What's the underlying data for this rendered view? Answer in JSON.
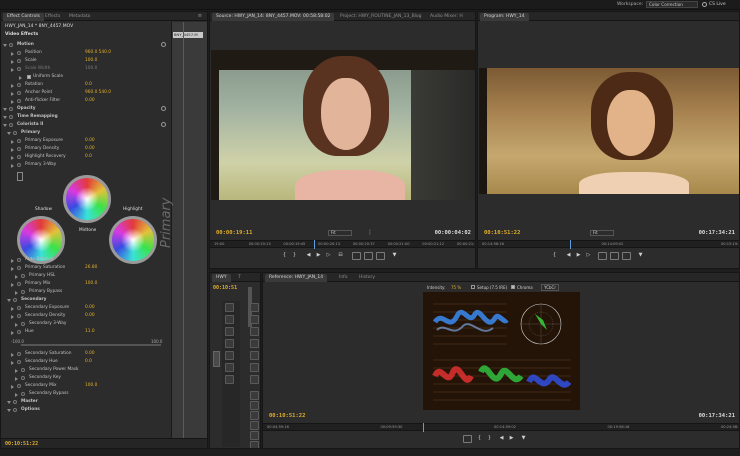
{
  "topbar": {
    "workspace_label": "Workspace:",
    "workspace_value": "Color Correction",
    "cs_live": "CS Live"
  },
  "effect_controls": {
    "tabs": [
      "Effect Controls",
      "Effects",
      "Metadata"
    ],
    "clip_name": "HWY_JAN_14 * 8NY_4457.MOV",
    "mini_clip": "8NY_4457.M",
    "section": "Video Effects",
    "rows": [
      {
        "label": "Motion",
        "value": "",
        "indent": 1,
        "fx": true
      },
      {
        "label": "Position",
        "value": "960.0   540.0",
        "indent": 3
      },
      {
        "label": "Scale",
        "value": "100.0",
        "indent": 3
      },
      {
        "label": "Scale Width",
        "value": "100.0",
        "indent": 3,
        "dim": true
      },
      {
        "label": "Uniform Scale",
        "value": "",
        "indent": 5,
        "check": true
      },
      {
        "label": "Rotation",
        "value": "0.0",
        "indent": 3
      },
      {
        "label": "Anchor Point",
        "value": "960.0   540.0",
        "indent": 3
      },
      {
        "label": "Anti-flicker Filter",
        "value": "0.00",
        "indent": 3
      },
      {
        "label": "Opacity",
        "value": "",
        "indent": 1,
        "fx": true
      },
      {
        "label": "Time Remapping",
        "value": "",
        "indent": 1
      },
      {
        "label": "Colorista II",
        "value": "",
        "indent": 1,
        "fx": true
      },
      {
        "label": "Primary",
        "value": "",
        "indent": 2
      },
      {
        "label": "Primary Exposure",
        "value": "0.00",
        "indent": 3
      },
      {
        "label": "Primary Density",
        "value": "0.00",
        "indent": 3
      },
      {
        "label": "Highlight Recovery",
        "value": "0.0",
        "indent": 3
      },
      {
        "label": "Primary 3-Way",
        "value": "",
        "indent": 3
      }
    ],
    "wheel_labels": {
      "shadow": "Shadow",
      "midtone": "Midtone",
      "highlight": "Highlight"
    },
    "primary_vertical": "Primary",
    "rows2": [
      {
        "label": "Auto Balance",
        "value": "",
        "indent": 3
      },
      {
        "label": "Primary Saturation",
        "value": "26.80",
        "indent": 3
      },
      {
        "label": "Primary HSL",
        "value": "",
        "indent": 4
      },
      {
        "label": "Primary Mix",
        "value": "100.0",
        "indent": 3
      },
      {
        "label": "Primary Bypass",
        "value": "",
        "indent": 4
      },
      {
        "label": "Secondary",
        "value": "",
        "indent": 2
      },
      {
        "label": "Secondary Exposure",
        "value": "0.00",
        "indent": 3
      },
      {
        "label": "Secondary Density",
        "value": "0.00",
        "indent": 3
      },
      {
        "label": "Secondary 3-Way",
        "value": "",
        "indent": 4
      },
      {
        "label": "Hue",
        "value": "11.0",
        "indent": 3
      }
    ],
    "hue_range": {
      "min": "-100.0",
      "max": "100.0"
    },
    "rows3": [
      {
        "label": "Secondary Saturation",
        "value": "0.00",
        "indent": 3
      },
      {
        "label": "Secondary Hue",
        "value": "0.0",
        "indent": 3
      },
      {
        "label": "Secondary Power Mask",
        "value": "",
        "indent": 4
      },
      {
        "label": "Secondary Key",
        "value": "",
        "indent": 4
      },
      {
        "label": "Secondary Mix",
        "value": "100.0",
        "indent": 3
      },
      {
        "label": "Secondary Bypass",
        "value": "",
        "indent": 4
      },
      {
        "label": "Master",
        "value": "",
        "indent": 2
      },
      {
        "label": "Options",
        "value": "",
        "indent": 2
      }
    ],
    "timecode": "00:10:51:22"
  },
  "source": {
    "tabs": [
      "Source: HWY_JAN_14: 8NY_4457.MOV: 00:58:58:02",
      "Project: HWY_ROUTINE_JAN_13_Blog",
      "Audio Mixer: H"
    ],
    "tc_left": "00:00:19:11",
    "fit": "Fit",
    "tc_right": "00:00:04:02",
    "ruler": [
      "19:00",
      "00:00:19:13",
      "00:00:19:45",
      "00:00:20:13",
      "00:00:20:37",
      "00:00:21:00",
      "00:00:21:12",
      "00:00:21:30"
    ]
  },
  "program": {
    "tabs": [
      "Program: HWY_14"
    ],
    "tc_left": "00:10:51:22",
    "fit": "Fit",
    "tc_right": "00:17:34:21",
    "ruler": [
      "00:14:56:16",
      "00:14:09:02",
      "00:15:19:38"
    ]
  },
  "tools": {
    "tabs": [
      "HWY",
      "T"
    ],
    "timecode": "00:10:51"
  },
  "reference": {
    "tabs": [
      "Reference: HWY_JAN_14",
      "Info",
      "History"
    ],
    "intensity_label": "Intensity:",
    "intensity_value": "75 %",
    "setup_label": "Setup (7.5 IRE)",
    "chroma_label": "Chroma",
    "ycbcr_label": "YCbCr",
    "tc_left": "00:10:51:22",
    "tc_right": "00:17:34:21",
    "ruler": [
      "00:04:59:16",
      "00:09:59:30",
      "00:14:59:02",
      "00:19:58:18",
      "00:24:58:12"
    ]
  },
  "colors": {
    "accent": "#e3b02a",
    "panel": "#2c2c2c",
    "playhead": "#d03030"
  }
}
